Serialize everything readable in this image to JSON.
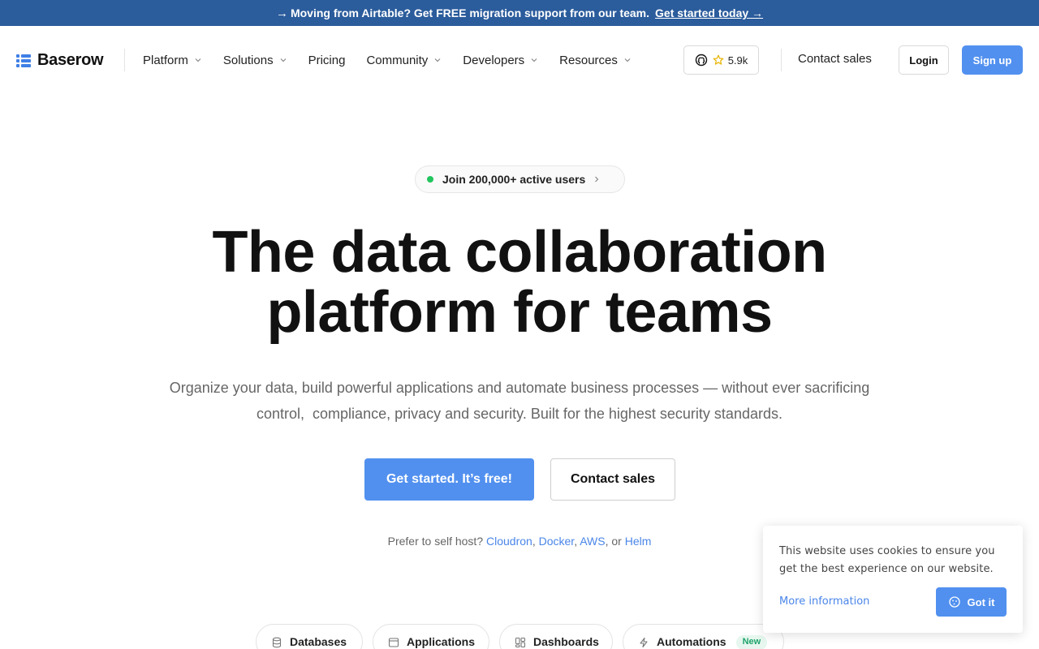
{
  "announcement": {
    "text": "Moving from Airtable? Get FREE migration support from our team.",
    "cta": "Get started today →"
  },
  "header": {
    "logo": "Baserow",
    "nav": [
      {
        "label": "Platform",
        "dropdown": true
      },
      {
        "label": "Solutions",
        "dropdown": true
      },
      {
        "label": "Pricing",
        "dropdown": false
      },
      {
        "label": "Community",
        "dropdown": true
      },
      {
        "label": "Developers",
        "dropdown": true
      },
      {
        "label": "Resources",
        "dropdown": true
      }
    ],
    "github_stars": "5.9k",
    "contact_sales": "Contact sales",
    "login": "Login",
    "signup": "Sign up"
  },
  "hero": {
    "pill": "Join 200,000+ active users",
    "title_line1": "The data collaboration",
    "title_line2": "platform for teams",
    "subtitle_line1": "Organize your data, build powerful applications and automate business processes — without ever sacrificing",
    "subtitle_line2": "control,  compliance, privacy and security. Built for the highest security standards.",
    "cta_primary": "Get started. It’s free!",
    "cta_secondary": "Contact sales",
    "selfhost_prefix": "Prefer to self host?",
    "selfhost_links": [
      "Cloudron",
      "Docker",
      "AWS",
      "Helm"
    ],
    "selfhost_sep1": ",",
    "selfhost_sep2": ",",
    "selfhost_or": ", or"
  },
  "tabs": [
    {
      "label": "Databases",
      "icon": "database-icon"
    },
    {
      "label": "Applications",
      "icon": "window-icon"
    },
    {
      "label": "Dashboards",
      "icon": "dashboard-icon"
    },
    {
      "label": "Automations",
      "icon": "lightning-icon",
      "badge": "New"
    }
  ],
  "cookie": {
    "text": "This website uses cookies to ensure you get the best experience on our website.",
    "more": "More information",
    "button": "Got it"
  },
  "colors": {
    "announcement_bg": "#2b5c9c",
    "primary": "#5190ef",
    "link": "#4a86e8",
    "status_dot": "#22c55e",
    "new_badge_text": "#1ea46a"
  }
}
